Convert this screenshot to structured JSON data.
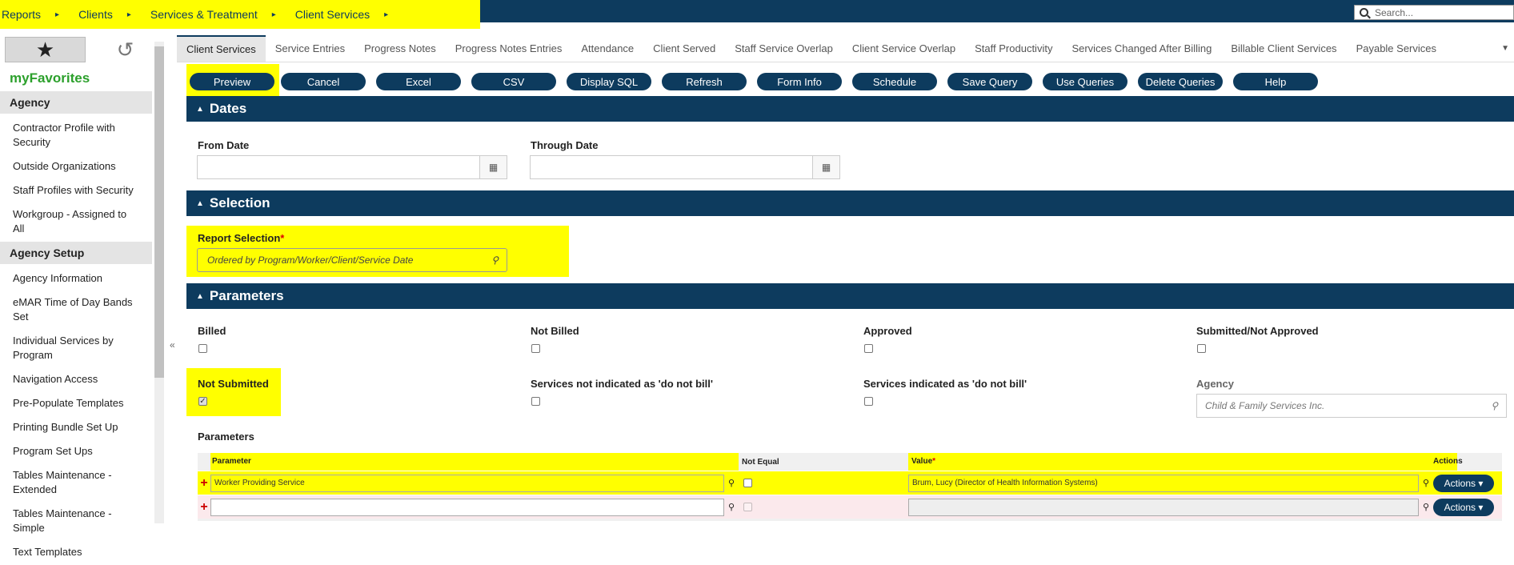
{
  "breadcrumb": [
    "Reports",
    "Clients",
    "Services & Treatment",
    "Client Services"
  ],
  "search": {
    "placeholder": "Search..."
  },
  "sidebar": {
    "title": "myFavorites",
    "sections": [
      {
        "heading": "Agency",
        "items": [
          "Contractor Profile with Security",
          "Outside Organizations",
          "Staff Profiles with Security",
          "Workgroup - Assigned to All"
        ]
      },
      {
        "heading": "Agency Setup",
        "items": [
          "Agency Information",
          "eMAR Time of Day Bands Set",
          "Individual Services by Program",
          "Navigation Access",
          "Pre-Populate Templates",
          "Printing Bundle Set Up",
          "Program Set Ups",
          "Tables Maintenance - Extended",
          "Tables Maintenance - Simple",
          "Text Templates"
        ]
      }
    ]
  },
  "tabs": [
    "Client Services",
    "Service Entries",
    "Progress Notes",
    "Progress Notes Entries",
    "Attendance",
    "Client Served",
    "Staff Service Overlap",
    "Client Service Overlap",
    "Staff Productivity",
    "Services Changed After Billing",
    "Billable Client Services",
    "Payable Services"
  ],
  "toolbar": [
    "Preview",
    "Cancel",
    "Excel",
    "CSV",
    "Display SQL",
    "Refresh",
    "Form Info",
    "Schedule",
    "Save Query",
    "Use Queries",
    "Delete Queries",
    "Help"
  ],
  "sections": {
    "dates": "Dates",
    "selection": "Selection",
    "parameters": "Parameters"
  },
  "dates": {
    "from": "From Date",
    "through": "Through Date"
  },
  "selection": {
    "label": "Report Selection",
    "required": "*",
    "value": "Ordered by Program/Worker/Client/Service Date"
  },
  "params": {
    "billed": "Billed",
    "not_billed": "Not Billed",
    "approved": "Approved",
    "submitted_not_approved": "Submitted/Not Approved",
    "not_submitted": "Not Submitted",
    "not_do_not_bill": "Services not indicated as 'do not bill'",
    "do_not_bill": "Services indicated as 'do not bill'",
    "agency_label": "Agency",
    "agency_placeholder": "Child & Family Services Inc.",
    "grid_title": "Parameters"
  },
  "grid": {
    "headers": {
      "parameter": "Parameter",
      "not_equal": "Not Equal",
      "value": "Value",
      "required": "*",
      "actions": "Actions"
    },
    "row1": {
      "parameter": "Worker Providing Service",
      "value": "Brum, Lucy (Director of Health Information Systems)",
      "actions": "Actions ▾"
    },
    "row2": {
      "actions": "Actions ▾"
    }
  }
}
